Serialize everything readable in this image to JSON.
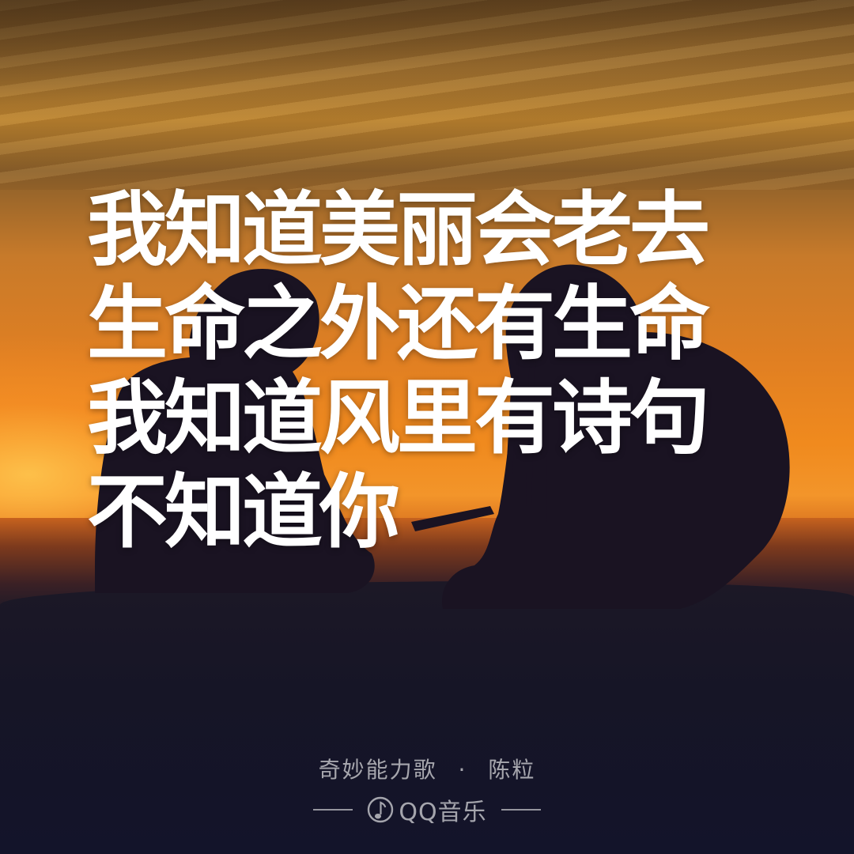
{
  "lyrics": {
    "lines": [
      "我知道美丽会老去",
      "生命之外还有生命",
      "我知道风里有诗句",
      "不知道你"
    ]
  },
  "credit": {
    "song": "奇妙能力歌",
    "separator": "·",
    "artist": "陈粒"
  },
  "brand": {
    "name": "QQ音乐",
    "icon": "music-note-icon"
  },
  "colors": {
    "text": "#ffffff",
    "sky_top": "#6b4a22",
    "sunset": "#f08a1e",
    "ground": "#141425"
  }
}
